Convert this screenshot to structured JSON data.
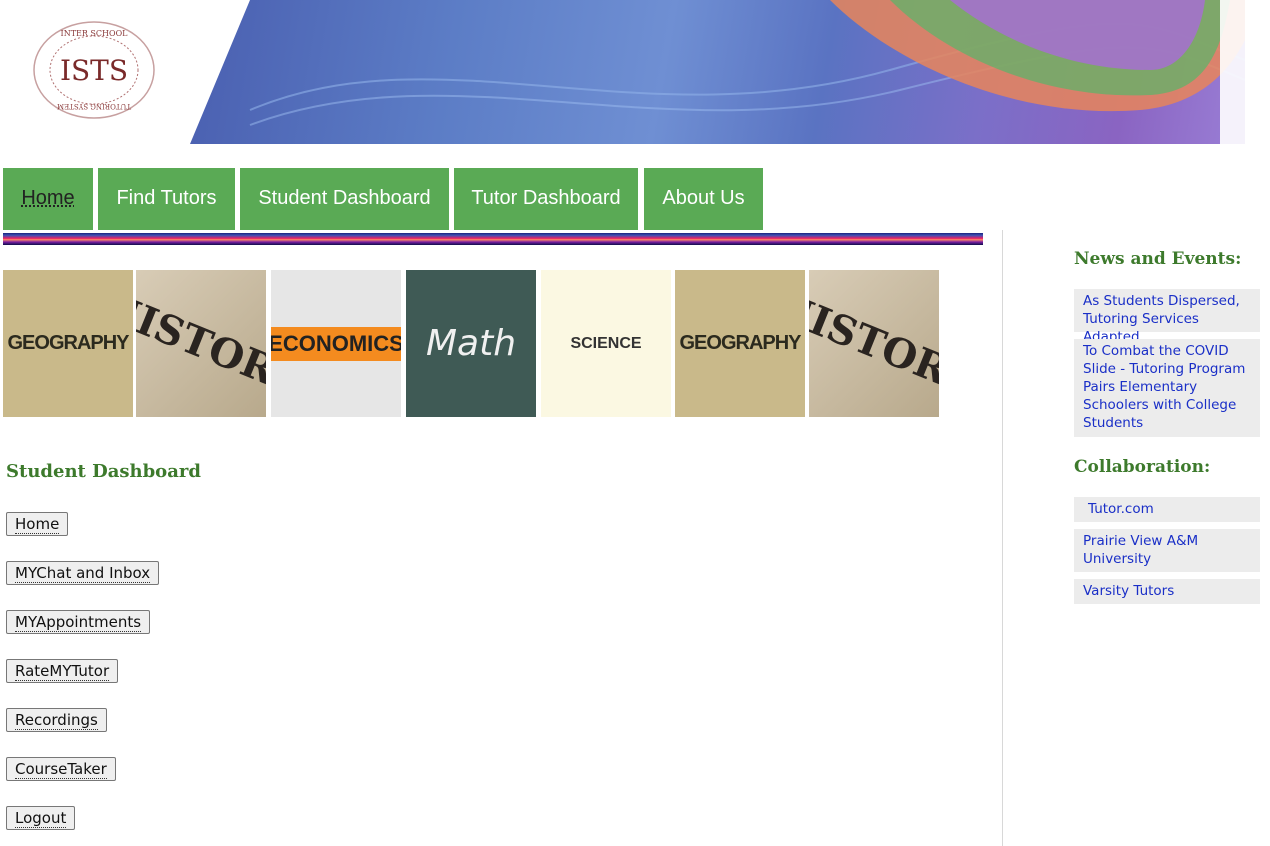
{
  "header": {
    "logo_text_top": "INTER SCHOOL",
    "logo_text_bottom": "TUTORING SYSTEM",
    "logo_monogram": "ISTS"
  },
  "nav": {
    "items": [
      {
        "label": "Home",
        "active": true
      },
      {
        "label": "Find Tutors"
      },
      {
        "label": "Student Dashboard"
      },
      {
        "label": "Tutor Dashboard"
      },
      {
        "label": "About Us"
      }
    ]
  },
  "subject_tiles": [
    {
      "label": "GEOGRAPHY"
    },
    {
      "label": "HISTORY"
    },
    {
      "label": "ECONOMICS"
    },
    {
      "label": "Math"
    },
    {
      "label": "SCIENCE"
    },
    {
      "label": "GEOGRAPHY"
    },
    {
      "label": "HISTORY"
    }
  ],
  "dashboard": {
    "title": "Student Dashboard",
    "buttons": [
      {
        "label": "Home"
      },
      {
        "label": "MYChat and Inbox"
      },
      {
        "label": "MYAppointments"
      },
      {
        "label": "RateMYTutor"
      },
      {
        "label": "Recordings"
      },
      {
        "label": "CourseTaker"
      },
      {
        "label": "Logout"
      }
    ]
  },
  "sidebar": {
    "news_title": "News and Events:",
    "news": [
      {
        "label": "As Students Dispersed, Tutoring Services Adapted"
      },
      {
        "label": "To Combat the COVID Slide - Tutoring Program Pairs Elementary Schoolers with College Students"
      }
    ],
    "collab_title": "Collaboration:",
    "collab": [
      {
        "label": "Tutor.com"
      },
      {
        "label": "Prairie View A&M University"
      },
      {
        "label": "Varsity Tutors"
      }
    ]
  },
  "colors": {
    "nav_green": "#5aaa55",
    "heading_green": "#3d7a2c",
    "link_blue": "#1a2fc7"
  }
}
